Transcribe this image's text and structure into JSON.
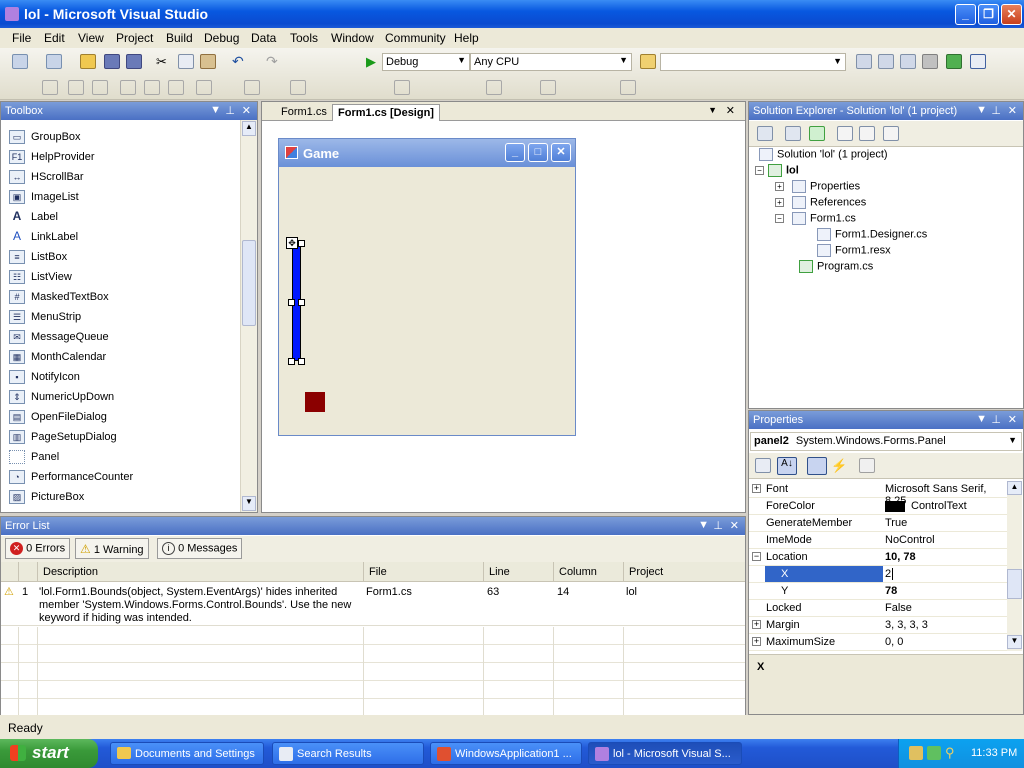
{
  "window": {
    "title": "lol - Microsoft Visual Studio"
  },
  "menu": [
    "File",
    "Edit",
    "View",
    "Project",
    "Build",
    "Debug",
    "Data",
    "Tools",
    "Window",
    "Community",
    "Help"
  ],
  "toolbar": {
    "config": "Debug",
    "platform": "Any CPU"
  },
  "toolbox": {
    "title": "Toolbox",
    "items": [
      "GroupBox",
      "HelpProvider",
      "HScrollBar",
      "ImageList",
      "Label",
      "LinkLabel",
      "ListBox",
      "ListView",
      "MaskedTextBox",
      "MenuStrip",
      "MessageQueue",
      "MonthCalendar",
      "NotifyIcon",
      "NumericUpDown",
      "OpenFileDialog",
      "PageSetupDialog",
      "Panel",
      "PerformanceCounter",
      "PictureBox"
    ]
  },
  "designer": {
    "tabs": [
      "Form1.cs",
      "Form1.cs [Design]"
    ],
    "form_title": "Game",
    "colors": {
      "paddle": "#0018ff",
      "block": "#8b0000"
    }
  },
  "solution_explorer": {
    "title": "Solution Explorer - Solution 'lol' (1 project)",
    "nodes": [
      "Solution 'lol' (1 project)",
      "lol",
      "Properties",
      "References",
      "Form1.cs",
      "Form1.Designer.cs",
      "Form1.resx",
      "Program.cs"
    ]
  },
  "properties": {
    "title": "Properties",
    "object": "panel2",
    "object_type": "System.Windows.Forms.Panel",
    "rows": [
      {
        "name": "Font",
        "value": "Microsoft Sans Serif, 8.25"
      },
      {
        "name": "ForeColor",
        "value": "ControlText"
      },
      {
        "name": "GenerateMember",
        "value": "True"
      },
      {
        "name": "ImeMode",
        "value": "NoControl"
      },
      {
        "name": "Location",
        "value": "10, 78"
      },
      {
        "name": "X",
        "value": "2"
      },
      {
        "name": "Y",
        "value": "78"
      },
      {
        "name": "Locked",
        "value": "False"
      },
      {
        "name": "Margin",
        "value": "3, 3, 3, 3"
      },
      {
        "name": "MaximumSize",
        "value": "0, 0"
      }
    ],
    "description": "X"
  },
  "error_list": {
    "title": "Error List",
    "errors_btn": "0 Errors",
    "warnings_btn": "1 Warning",
    "messages_btn": "0 Messages",
    "columns": [
      "Description",
      "File",
      "Line",
      "Column",
      "Project"
    ],
    "rows": [
      {
        "num": "1",
        "description": "'lol.Form1.Bounds(object, System.EventArgs)' hides inherited member 'System.Windows.Forms.Control.Bounds'. Use the new keyword if hiding was intended.",
        "file": "Form1.cs",
        "line": "63",
        "column": "14",
        "project": "lol"
      }
    ]
  },
  "status": "Ready",
  "taskbar": {
    "start": "start",
    "tasks": [
      "Documents and Settings",
      "Search Results",
      "WindowsApplication1 ...",
      "lol - Microsoft Visual S..."
    ],
    "clock": "11:33 PM"
  }
}
